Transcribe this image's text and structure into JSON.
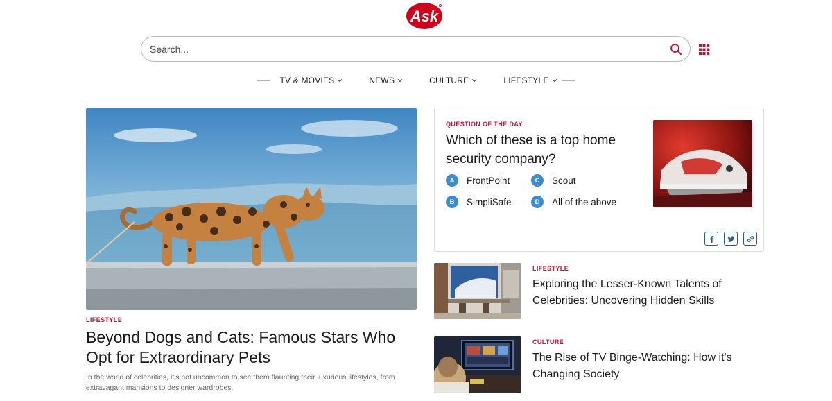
{
  "brand": {
    "name": "Ask",
    "accent": "#c8102e"
  },
  "search": {
    "placeholder": "Search...",
    "value": ""
  },
  "nav": {
    "items": [
      {
        "label": "TV & MOVIES"
      },
      {
        "label": "NEWS"
      },
      {
        "label": "CULTURE"
      },
      {
        "label": "LIFESTYLE"
      }
    ]
  },
  "hero": {
    "category": "LIFESTYLE",
    "title": "Beyond Dogs and Cats: Famous Stars Who Opt for Extraordinary Pets",
    "description": "In the world of celebrities, it's not uncommon to see them flaunting their luxurious lifestyles, from extravagant mansions to designer wardrobes."
  },
  "question": {
    "label": "QUESTION OF THE DAY",
    "text": "Which of these is a top home security company?",
    "options": [
      {
        "letter": "A",
        "text": "FrontPoint"
      },
      {
        "letter": "B",
        "text": "SimpliSafe"
      },
      {
        "letter": "C",
        "text": "Scout"
      },
      {
        "letter": "D",
        "text": "All of the above"
      }
    ],
    "share": [
      "facebook-icon",
      "twitter-icon",
      "link-icon"
    ]
  },
  "stories": [
    {
      "category": "LIFESTYLE",
      "title": "Exploring the Lesser-Known Talents of Celebrities: Uncovering Hidden Skills"
    },
    {
      "category": "CULTURE",
      "title": "The Rise of TV Binge-Watching: How it's Changing Society"
    }
  ],
  "colors": {
    "option_bubble": "#3a8ed0",
    "category": "#c8102e",
    "share_border": "#2d5e8a"
  }
}
